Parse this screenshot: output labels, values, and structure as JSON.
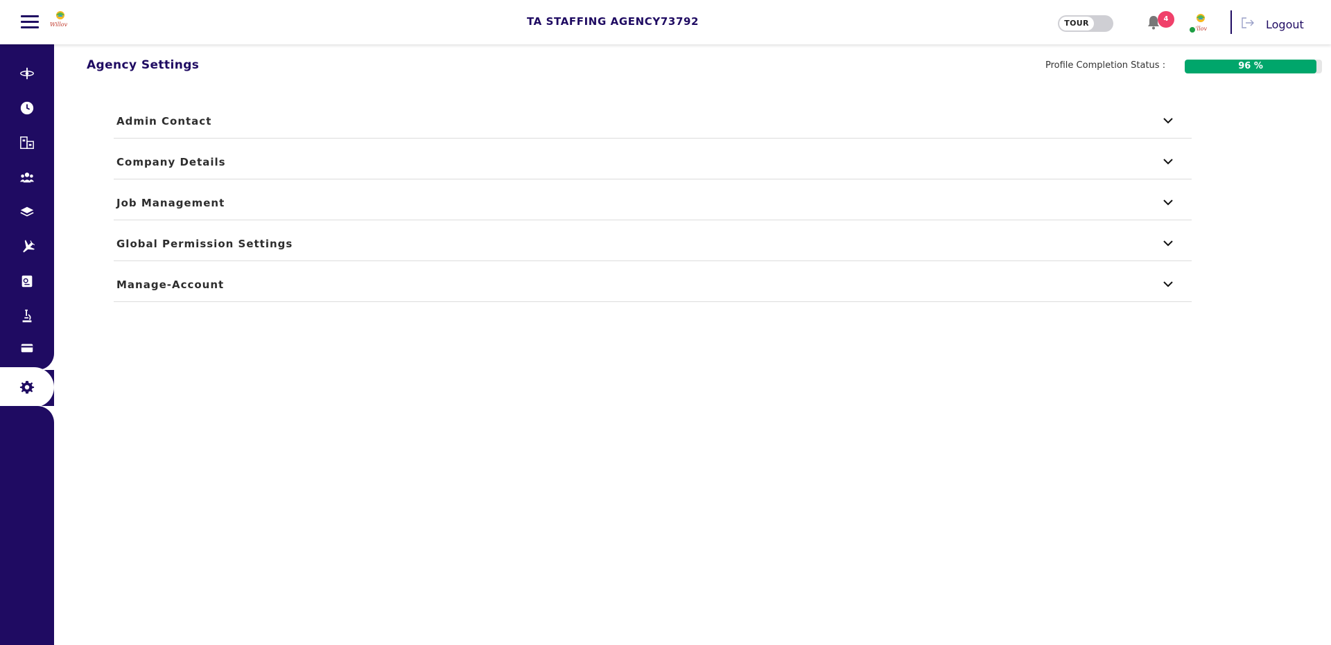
{
  "header": {
    "app_title": "TA STAFFING AGENCY73792",
    "logo_text": "Willov",
    "tour_label": "TOUR",
    "notification_count": "4",
    "logout_label": "Logout"
  },
  "sidebar": {
    "items": [
      {
        "icon": "dashboard-icon"
      },
      {
        "icon": "clock-icon"
      },
      {
        "icon": "building-icon"
      },
      {
        "icon": "users-icon"
      },
      {
        "icon": "layers-icon"
      },
      {
        "icon": "plane-icon"
      },
      {
        "icon": "document-icon"
      },
      {
        "icon": "microscope-icon"
      },
      {
        "icon": "credit-card-icon"
      },
      {
        "icon": "gear-icon",
        "active": true
      }
    ]
  },
  "main": {
    "page_title": "Agency Settings",
    "profile_completion_label": "Profile Completion Status :",
    "profile_completion_value": "96 %",
    "profile_completion_fraction": 0.96,
    "sections": [
      {
        "label": "Admin Contact"
      },
      {
        "label": "Company Details"
      },
      {
        "label": "Job Management"
      },
      {
        "label": "Global Permission Settings"
      },
      {
        "label": "Manage-Account"
      }
    ]
  },
  "colors": {
    "primary": "#1f0b62",
    "progress": "#00a66b",
    "badge": "#f0406a",
    "online": "#1e9e44"
  }
}
